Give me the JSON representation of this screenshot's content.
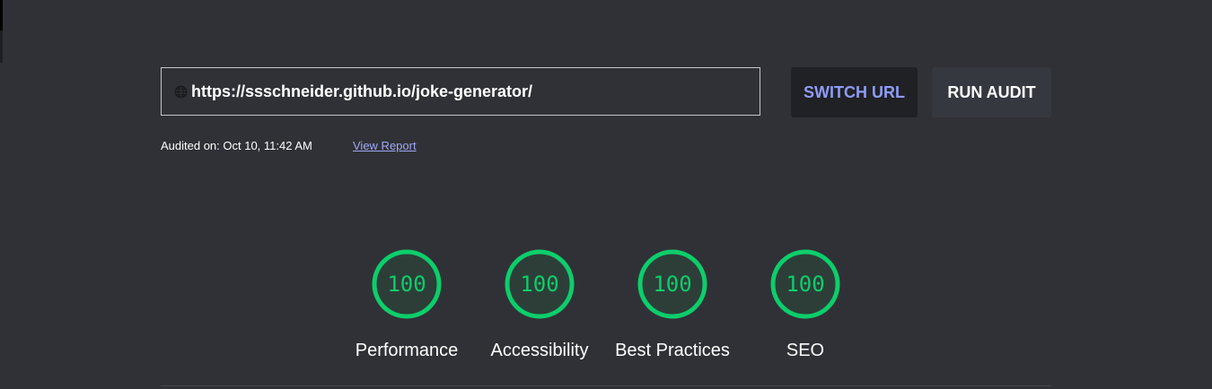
{
  "url_bar": {
    "value": "https://ssschneider.github.io/joke-generator/",
    "icon": "globe-icon"
  },
  "buttons": {
    "switch_url": "SWITCH URL",
    "run_audit": "RUN AUDIT"
  },
  "audit_info": {
    "audited_on": "Audited on: Oct 10, 11:42 AM",
    "view_report": "View Report"
  },
  "scores": [
    {
      "label": "Performance",
      "value": "100",
      "percent": 100
    },
    {
      "label": "Accessibility",
      "value": "100",
      "percent": 100
    },
    {
      "label": "Best Practices",
      "value": "100",
      "percent": 100
    },
    {
      "label": "SEO",
      "value": "100",
      "percent": 100
    }
  ],
  "colors": {
    "background": "#303136",
    "score_pass": "#0cce6b",
    "link": "#a0a8f8",
    "switch_button_text": "#8e9cf9"
  }
}
